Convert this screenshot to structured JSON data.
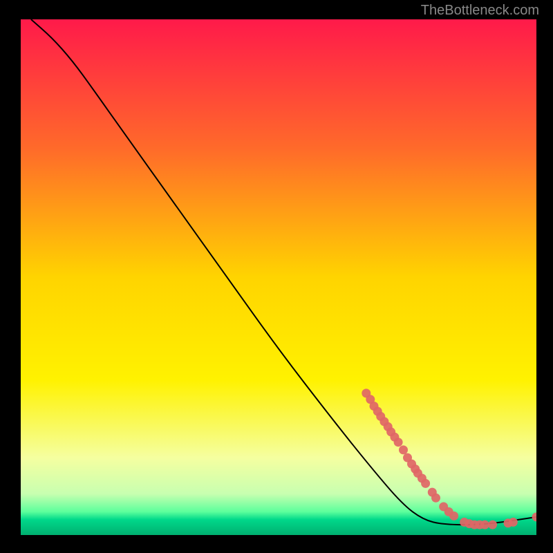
{
  "watermark": "TheBottleneck.com",
  "chart_data": {
    "type": "line",
    "title": "",
    "xlabel": "",
    "ylabel": "",
    "xlim": [
      0,
      100
    ],
    "ylim": [
      0,
      100
    ],
    "gradient_stops": [
      {
        "offset": 0,
        "color": "#ff1a4a"
      },
      {
        "offset": 25,
        "color": "#ff6a2a"
      },
      {
        "offset": 50,
        "color": "#ffd400"
      },
      {
        "offset": 70,
        "color": "#fff200"
      },
      {
        "offset": 85,
        "color": "#f5ffa0"
      },
      {
        "offset": 92,
        "color": "#c8ffb0"
      },
      {
        "offset": 95.5,
        "color": "#5cff9c"
      },
      {
        "offset": 97,
        "color": "#00d88a"
      },
      {
        "offset": 100,
        "color": "#00b070"
      }
    ],
    "curve": [
      {
        "x": 2,
        "y": 100
      },
      {
        "x": 6,
        "y": 96.5
      },
      {
        "x": 10,
        "y": 92
      },
      {
        "x": 14,
        "y": 86.5
      },
      {
        "x": 20,
        "y": 78
      },
      {
        "x": 30,
        "y": 64
      },
      {
        "x": 40,
        "y": 50
      },
      {
        "x": 50,
        "y": 36
      },
      {
        "x": 60,
        "y": 23
      },
      {
        "x": 68,
        "y": 13
      },
      {
        "x": 74,
        "y": 6
      },
      {
        "x": 78,
        "y": 3
      },
      {
        "x": 82,
        "y": 2
      },
      {
        "x": 90,
        "y": 2
      },
      {
        "x": 100,
        "y": 3.5
      }
    ],
    "points": [
      {
        "x": 67.0,
        "y": 27.5
      },
      {
        "x": 67.8,
        "y": 26.3
      },
      {
        "x": 68.5,
        "y": 25.0
      },
      {
        "x": 69.2,
        "y": 24.0
      },
      {
        "x": 69.8,
        "y": 23.0
      },
      {
        "x": 70.5,
        "y": 22.0
      },
      {
        "x": 71.2,
        "y": 21.0
      },
      {
        "x": 71.8,
        "y": 20.0
      },
      {
        "x": 72.5,
        "y": 19.0
      },
      {
        "x": 73.2,
        "y": 18.0
      },
      {
        "x": 74.2,
        "y": 16.5
      },
      {
        "x": 75.0,
        "y": 15.0
      },
      {
        "x": 75.8,
        "y": 13.8
      },
      {
        "x": 76.5,
        "y": 12.8
      },
      {
        "x": 77.0,
        "y": 12.0
      },
      {
        "x": 77.8,
        "y": 11.0
      },
      {
        "x": 78.5,
        "y": 10.0
      },
      {
        "x": 79.8,
        "y": 8.3
      },
      {
        "x": 80.5,
        "y": 7.2
      },
      {
        "x": 82.0,
        "y": 5.5
      },
      {
        "x": 83.0,
        "y": 4.5
      },
      {
        "x": 84.0,
        "y": 3.7
      },
      {
        "x": 86.0,
        "y": 2.5
      },
      {
        "x": 87.0,
        "y": 2.2
      },
      {
        "x": 88.0,
        "y": 2.0
      },
      {
        "x": 89.0,
        "y": 2.0
      },
      {
        "x": 90.0,
        "y": 2.0
      },
      {
        "x": 91.5,
        "y": 2.0
      },
      {
        "x": 94.5,
        "y": 2.3
      },
      {
        "x": 95.5,
        "y": 2.5
      },
      {
        "x": 100.0,
        "y": 3.5
      }
    ],
    "series_color_line": "#000000",
    "series_color_point": "#e06666"
  }
}
